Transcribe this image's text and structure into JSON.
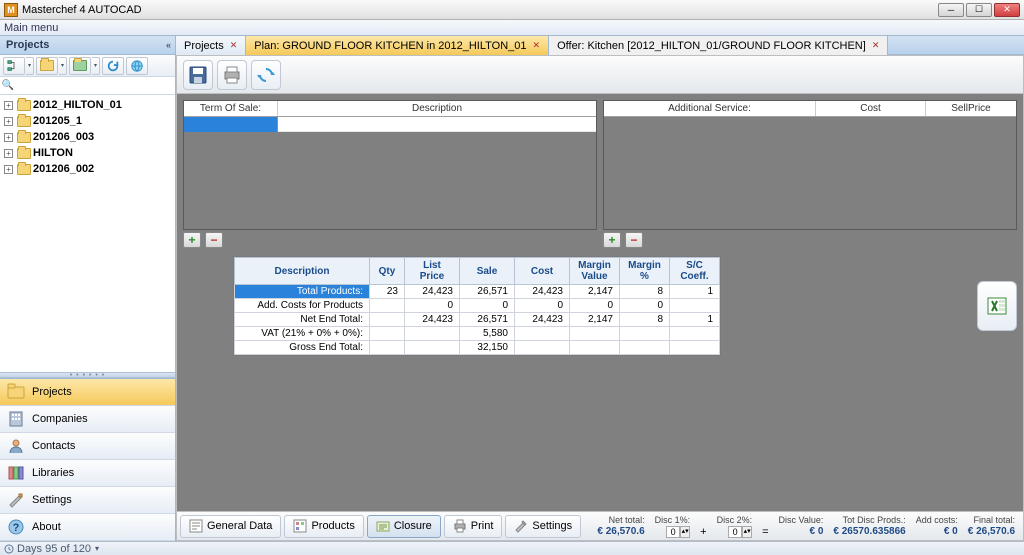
{
  "app": {
    "title": "Masterchef 4 AUTOCAD",
    "menu": "Main menu"
  },
  "sidebar": {
    "header": "Projects",
    "tree": [
      {
        "label": "2012_HILTON_01"
      },
      {
        "label": "201205_1"
      },
      {
        "label": "201206_003"
      },
      {
        "label": "HILTON"
      },
      {
        "label": "201206_002"
      }
    ],
    "nav": [
      {
        "label": "Projects"
      },
      {
        "label": "Companies"
      },
      {
        "label": "Contacts"
      },
      {
        "label": "Libraries"
      },
      {
        "label": "Settings"
      },
      {
        "label": "About"
      }
    ]
  },
  "tabs": [
    {
      "label": "Projects"
    },
    {
      "label": "Plan: GROUND FLOOR KITCHEN in 2012_HILTON_01"
    },
    {
      "label": "Offer: Kitchen [2012_HILTON_01/GROUND FLOOR KITCHEN]"
    }
  ],
  "leftgrid": {
    "cols": [
      "Term Of Sale:",
      "Description"
    ]
  },
  "rightgrid": {
    "cols": [
      "Additional Service:",
      "Cost",
      "SellPrice"
    ]
  },
  "summary": {
    "headers": [
      "Description",
      "Qty",
      "List Price",
      "Sale",
      "Cost",
      "Margin Value",
      "Margin %",
      "S/C Coeff."
    ],
    "rows": [
      {
        "desc": "Total Products:",
        "qty": "23",
        "list": "24,423",
        "sale": "26,571",
        "cost": "24,423",
        "mval": "2,147",
        "mpct": "8",
        "sc": "1",
        "sel": true
      },
      {
        "desc": "Add. Costs for Products",
        "qty": "",
        "list": "0",
        "sale": "0",
        "cost": "0",
        "mval": "0",
        "mpct": "0",
        "sc": ""
      },
      {
        "desc": "Net End Total:",
        "qty": "",
        "list": "24,423",
        "sale": "26,571",
        "cost": "24,423",
        "mval": "2,147",
        "mpct": "8",
        "sc": "1"
      },
      {
        "desc": "VAT (21% + 0% + 0%):",
        "qty": "",
        "list": "",
        "sale": "5,580",
        "cost": "",
        "mval": "",
        "mpct": "",
        "sc": ""
      },
      {
        "desc": "Gross End Total:",
        "qty": "",
        "list": "",
        "sale": "32,150",
        "cost": "",
        "mval": "",
        "mpct": "",
        "sc": ""
      }
    ]
  },
  "docbottom": {
    "buttons": [
      "General Data",
      "Products",
      "Closure",
      "Print",
      "Settings"
    ],
    "totals": {
      "net": {
        "label": "Net total:",
        "value": "€  26,570.6"
      },
      "d1": {
        "label": "Disc 1%:",
        "value": "0"
      },
      "d2": {
        "label": "Disc 2%:",
        "value": "0"
      },
      "disc": {
        "label": "Disc Value:",
        "value": "€  0"
      },
      "tdp": {
        "label": "Tot Disc Prods.:",
        "value": "€  26570.635866"
      },
      "add": {
        "label": "Add costs:",
        "value": "€  0"
      },
      "final": {
        "label": "Final total:",
        "value": "€  26,570.6"
      }
    }
  },
  "status": {
    "text": "Days 95 of 120"
  }
}
